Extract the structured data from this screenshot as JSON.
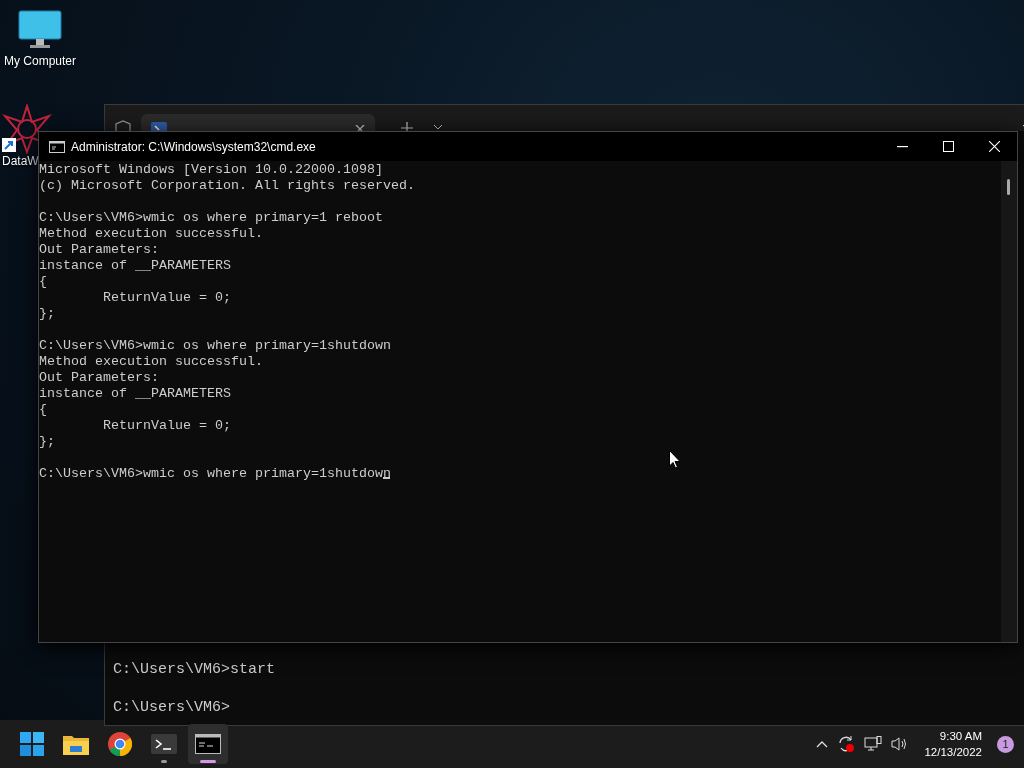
{
  "desktop_icons": [
    {
      "label": "My Computer",
      "kind": "computer"
    },
    {
      "label": "DataW",
      "kind": "shortcut"
    }
  ],
  "background_window": {
    "blocks": [
      [
        "C:\\Users\\VM6>start"
      ],
      [
        "C:\\Users\\VM6>"
      ]
    ]
  },
  "cmd_window": {
    "title": "Administrator: C:\\Windows\\system32\\cmd.exe",
    "blocks": [
      [
        "Microsoft Windows [Version 10.0.22000.1098]",
        "(c) Microsoft Corporation. All rights reserved."
      ],
      [
        "C:\\Users\\VM6>wmic os where primary=1 reboot",
        "Method execution successful.",
        "Out Parameters:",
        "instance of __PARAMETERS",
        "{",
        "        ReturnValue = 0;",
        "};"
      ],
      [
        "C:\\Users\\VM6>wmic os where primary=1shutdown",
        "Method execution successful.",
        "Out Parameters:",
        "instance of __PARAMETERS",
        "{",
        "        ReturnValue = 0;",
        "};"
      ],
      [
        "C:\\Users\\VM6>wmic os where primary=1shutdown"
      ]
    ]
  },
  "taskbar": {
    "apps": [
      {
        "kind": "start",
        "running": false,
        "selected": false
      },
      {
        "kind": "explorer",
        "running": false,
        "selected": false
      },
      {
        "kind": "chrome",
        "running": false,
        "selected": false
      },
      {
        "kind": "terminal",
        "running": true,
        "selected": false
      },
      {
        "kind": "cmd",
        "running": true,
        "selected": true
      }
    ],
    "clock": {
      "time": "9:30 AM",
      "date": "12/13/2022"
    },
    "notification_count": "1"
  }
}
